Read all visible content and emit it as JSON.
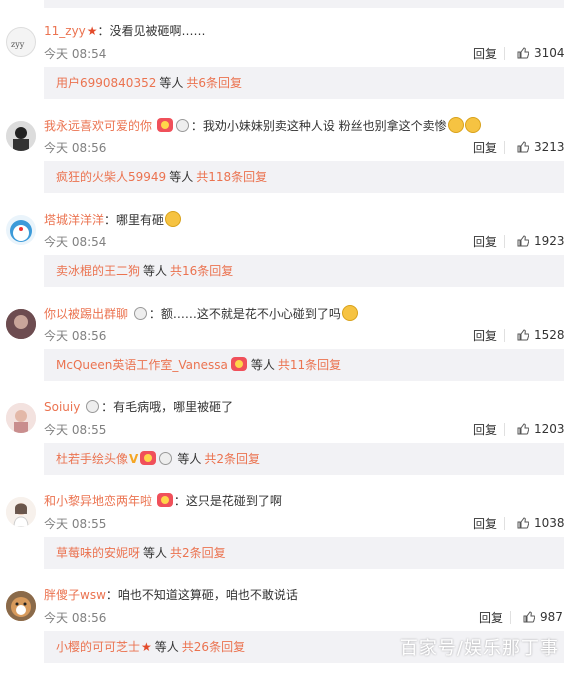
{
  "watermark": "百家号/娱乐那丁事",
  "reply_label": "回复",
  "etc_label": "等人",
  "comments": [
    {
      "username": "11_zyy",
      "content": "：没看见被砸啊……",
      "time": "今天 08:54",
      "likes": "3104",
      "sub_user": "用户6990840352",
      "sub_total": "共6条回复"
    },
    {
      "username": "我永远喜欢可爱的你",
      "content": "：我劝小妹妹别卖这种人设 粉丝也别拿这个卖惨",
      "time": "今天 08:56",
      "likes": "3213",
      "sub_user": "疯狂的火柴人59949",
      "sub_total": "共118条回复"
    },
    {
      "username": "塔城洋洋洋",
      "content": "：哪里有砸",
      "time": "今天 08:54",
      "likes": "1923",
      "sub_user": "卖冰棍的王二狗",
      "sub_total": "共16条回复"
    },
    {
      "username": "你以被踢出群聊",
      "content": "：额……这不就是花不小心碰到了吗",
      "time": "今天 08:56",
      "likes": "1528",
      "sub_user": "McQueen英语工作室_Vanessa",
      "sub_total": "共11条回复"
    },
    {
      "username": "Soiuiy",
      "content": "：有毛病哦，哪里被砸了",
      "time": "今天 08:55",
      "likes": "1203",
      "sub_user": "杜若手绘头像",
      "sub_total": "共2条回复"
    },
    {
      "username": "和小黎异地恋两年啦",
      "content": "：这只是花碰到了啊",
      "time": "今天 08:55",
      "likes": "1038",
      "sub_user": "草莓味的安妮呀",
      "sub_total": "共2条回复"
    },
    {
      "username": "胖傻子wsw",
      "content": "：咱也不知道这算砸，咱也不敢说话",
      "time": "今天 08:56",
      "likes": "987",
      "sub_user": "小樱的可可芝士",
      "sub_total": "共26条回复"
    }
  ],
  "icons": {
    "like": "thumbs-up-icon",
    "star": "red-star-icon"
  },
  "colors": {
    "username": "#eb7350",
    "sub_bg": "#f2f2f5",
    "time": "#808080"
  }
}
